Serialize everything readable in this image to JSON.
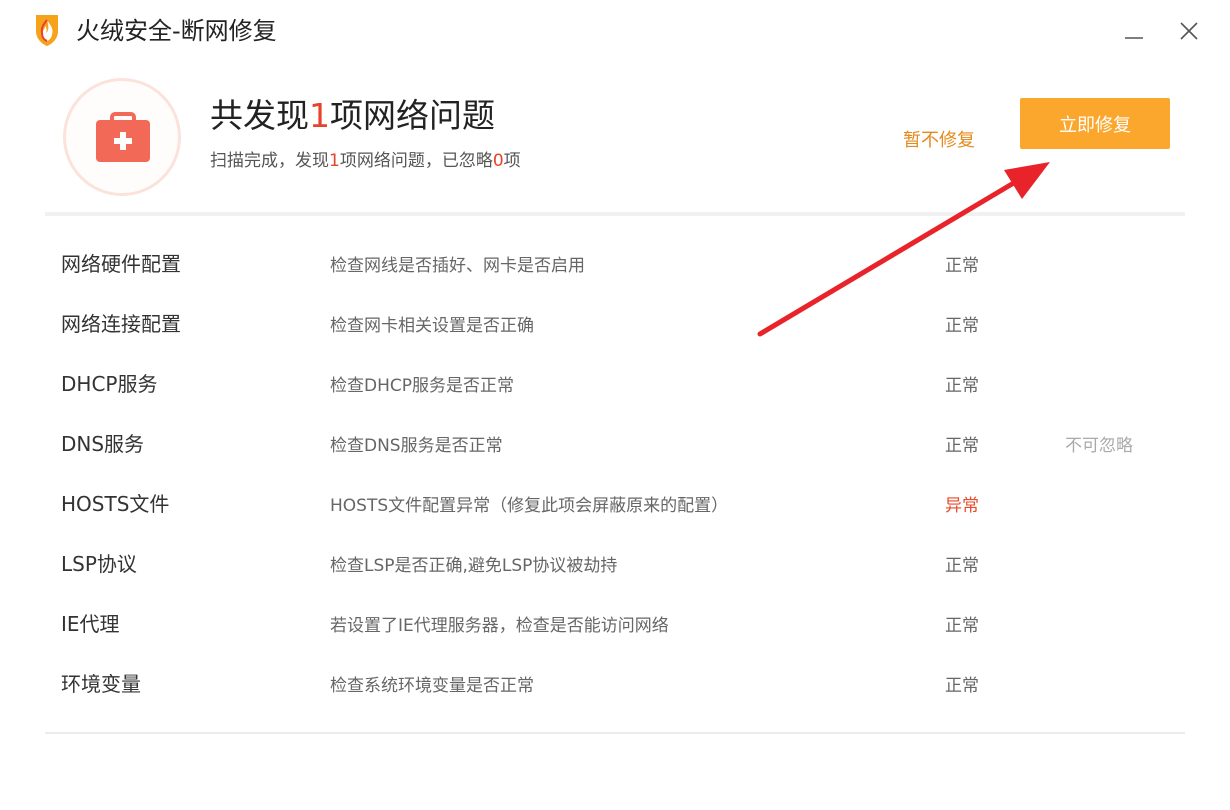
{
  "app": {
    "title": "火绒安全-断网修复"
  },
  "summary": {
    "headline_prefix": "共发现",
    "headline_count": "1",
    "headline_suffix": "项网络问题",
    "sub_prefix": "扫描完成，发现",
    "sub_found": "1",
    "sub_middle": "项网络问题，已忽略",
    "sub_ignored": "0",
    "sub_suffix": "项"
  },
  "actions": {
    "skip_label": "暂不修复",
    "fix_label": "立即修复"
  },
  "items": [
    {
      "name": "网络硬件配置",
      "desc": "检查网线是否插好、网卡是否启用",
      "status": "正常",
      "extra": ""
    },
    {
      "name": "网络连接配置",
      "desc": "检查网卡相关设置是否正确",
      "status": "正常",
      "extra": ""
    },
    {
      "name": "DHCP服务",
      "desc": "检查DHCP服务是否正常",
      "status": "正常",
      "extra": ""
    },
    {
      "name": "DNS服务",
      "desc": "检查DNS服务是否正常",
      "status": "正常",
      "extra": "不可忽略"
    },
    {
      "name": "HOSTS文件",
      "desc": "HOSTS文件配置异常（修复此项会屏蔽原来的配置）",
      "status": "异常",
      "extra": ""
    },
    {
      "name": "LSP协议",
      "desc": "检查LSP是否正确,避免LSP协议被劫持",
      "status": "正常",
      "extra": ""
    },
    {
      "name": "IE代理",
      "desc": "若设置了IE代理服务器，检查是否能访问网络",
      "status": "正常",
      "extra": ""
    },
    {
      "name": "环境变量",
      "desc": "检查系统环境变量是否正常",
      "status": "正常",
      "extra": ""
    }
  ],
  "colors": {
    "accent": "#fba72d",
    "error": "#e84a2b",
    "link": "#e48a1c",
    "annotation_arrow": "#e8232a"
  },
  "icons": {
    "logo": "huorong-flame-icon",
    "kit": "first-aid-kit-icon",
    "minimize": "minimize-icon",
    "close": "close-icon"
  }
}
